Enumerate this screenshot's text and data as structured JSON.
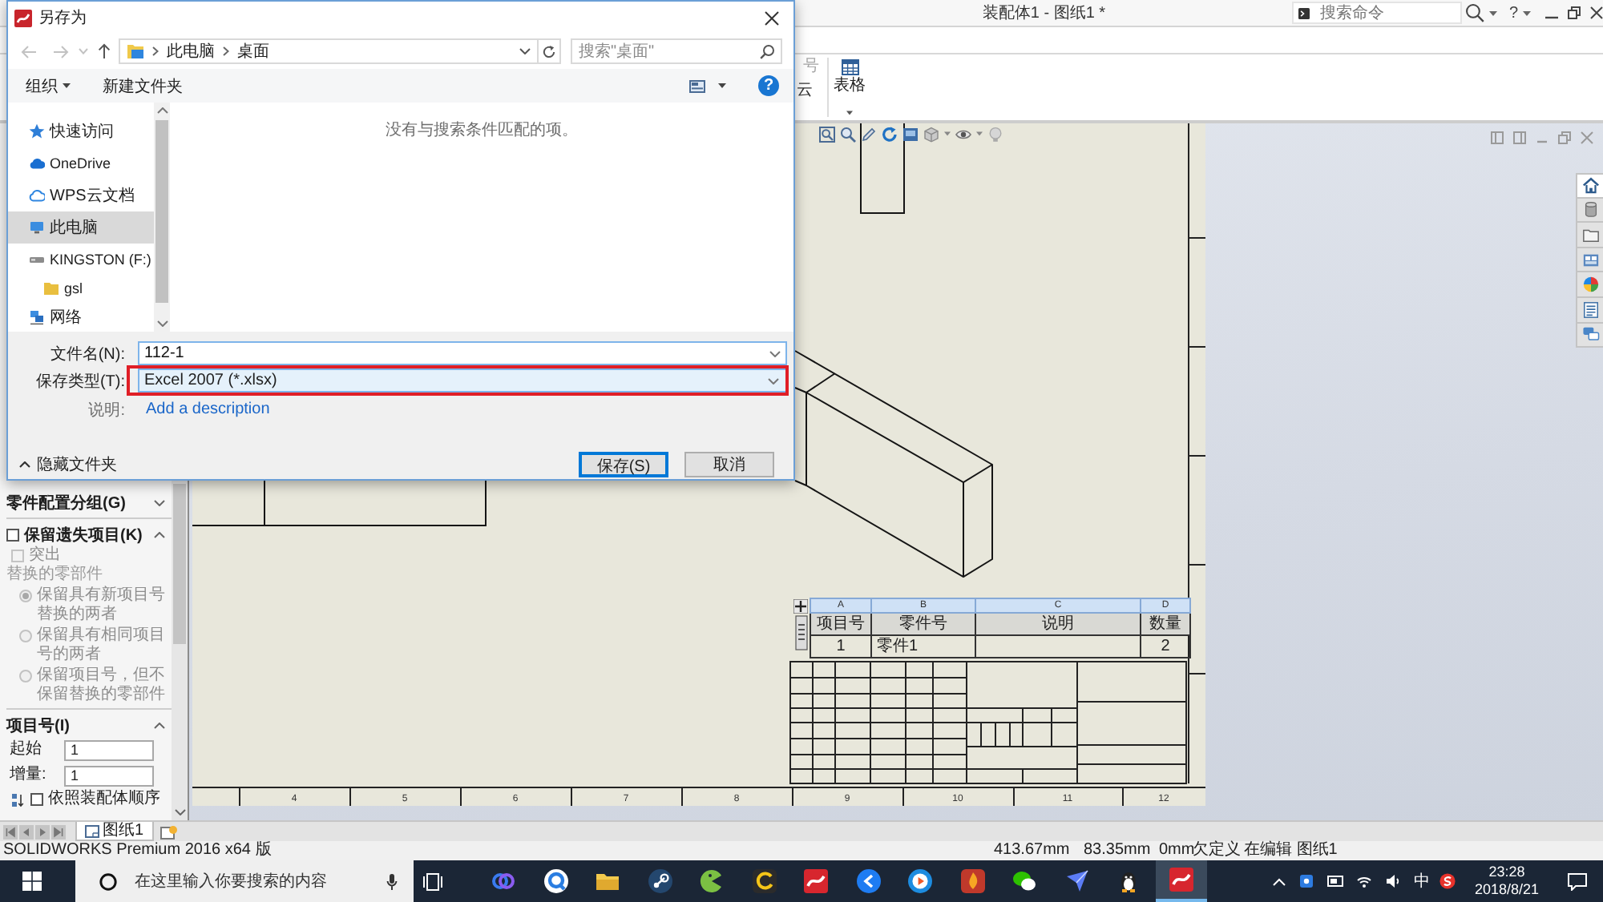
{
  "app_window": {
    "title": "装配体1 - 图纸1 *",
    "command_search": {
      "placeholder": "搜索命令"
    },
    "help": "?"
  },
  "ribbon": {
    "partial_labels": [
      "号",
      "云"
    ],
    "tools": [
      {
        "label": "表格"
      }
    ]
  },
  "save_dialog": {
    "title": "另存为",
    "address": {
      "path": [
        "此电脑",
        "桌面"
      ]
    },
    "search": {
      "placeholder": "搜索\"桌面\""
    },
    "toolbar": {
      "organize": "组织",
      "new_folder": "新建文件夹",
      "help": "?"
    },
    "nav_pane": [
      {
        "label": "快速访问",
        "selected": false
      },
      {
        "label": "OneDrive",
        "selected": false
      },
      {
        "label": "WPS云文档",
        "selected": false
      },
      {
        "label": "此电脑",
        "selected": true
      },
      {
        "label": "KINGSTON (F:)",
        "selected": false,
        "children": [
          {
            "label": "gsl",
            "selected": false
          }
        ]
      },
      {
        "label": "网络",
        "selected": false
      }
    ],
    "empty_message": "没有与搜索条件匹配的项。",
    "file_name": {
      "label": "文件名(N):",
      "value": "112-1"
    },
    "file_type": {
      "label": "保存类型(T):",
      "value": "Excel 2007 (*.xlsx)",
      "highlighted": true
    },
    "description": {
      "label": "说明:",
      "link": "Add a description"
    },
    "hide_folders": "隐藏文件夹",
    "buttons": [
      {
        "label": "保存(S)",
        "default": true
      },
      {
        "label": "取消",
        "default": false
      }
    ]
  },
  "property_manager": {
    "groups": [
      {
        "title": "零件配置分组(G)",
        "kind": "plain",
        "expanded": false
      },
      {
        "title": "保留遗失项目(K)",
        "kind": "checkbox",
        "checked": false,
        "expanded": true,
        "items": [
          {
            "kind": "checkbox",
            "label": "突出",
            "checked": false,
            "disabled": true
          },
          {
            "kind": "caption",
            "label": "替换的零部件"
          },
          {
            "kind": "radio",
            "label": "保留具有新项目号替换的两者",
            "selected": true,
            "disabled": true
          },
          {
            "kind": "radio",
            "label": "保留具有相同项目号的两者",
            "selected": false,
            "disabled": true
          },
          {
            "kind": "radio",
            "label": "保留项目号，但不保留替换的零部件",
            "selected": false,
            "disabled": true
          }
        ]
      },
      {
        "title": "项目号(I)",
        "kind": "plain",
        "expanded": true,
        "items": [
          {
            "kind": "field",
            "label": "起始",
            "value": "1"
          },
          {
            "kind": "field",
            "label": "增量:",
            "value": "1"
          },
          {
            "kind": "icon_checkbox",
            "label": "依照装配体顺序",
            "checked": false,
            "disabled": false
          }
        ]
      }
    ]
  },
  "drawing": {
    "bom": {
      "column_letters": [
        "A",
        "B",
        "C",
        "D"
      ],
      "headers": [
        "项目号",
        "零件号",
        "说明",
        "数量"
      ],
      "rows": [
        {
          "item_no": "1",
          "part_no": "零件1",
          "quantity": "2"
        }
      ]
    },
    "zone_numbers": [
      "4",
      "5",
      "6",
      "7",
      "8",
      "9",
      "10",
      "11",
      "12"
    ]
  },
  "task_pane_tabs": [
    {
      "selected": true
    },
    {
      "selected": false
    },
    {
      "selected": false
    },
    {
      "selected": false
    },
    {
      "selected": false
    },
    {
      "selected": false
    },
    {
      "selected": false
    }
  ],
  "sheet_tabs": [
    {
      "label": "图纸1"
    }
  ],
  "status_bar": {
    "product": "SOLIDWORKS Premium 2016 x64 版",
    "fields": [
      "413.67mm",
      "83.35mm",
      "0mm",
      "欠定义",
      "在编辑 图纸1"
    ]
  },
  "taskbar": {
    "search": {
      "placeholder": "在这里输入你要搜索的内容"
    },
    "apps": [
      {
        "active": false
      },
      {
        "active": false
      },
      {
        "active": false
      },
      {
        "active": false
      },
      {
        "active": false
      },
      {
        "active": false
      },
      {
        "active": false
      },
      {
        "active": false
      },
      {
        "active": false
      },
      {
        "active": false
      },
      {
        "active": false
      },
      {
        "active": false
      },
      {
        "active": false
      },
      {
        "active": true
      }
    ],
    "tray": {
      "input_method": "中",
      "time": "23:28",
      "date": "2018/8/21"
    }
  }
}
